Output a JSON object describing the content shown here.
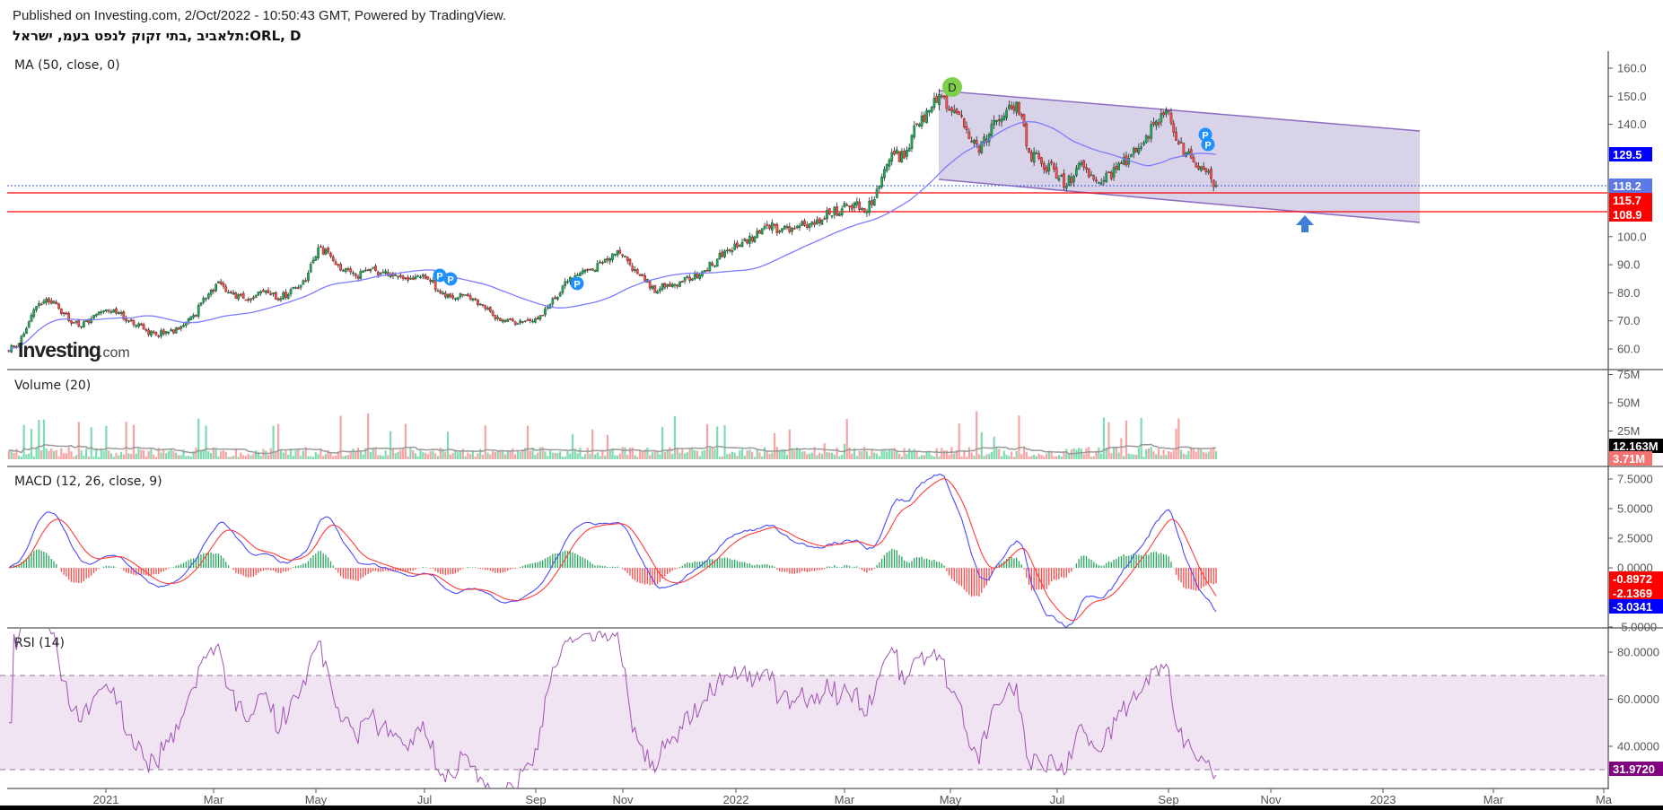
{
  "header": {
    "published": "Published on Investing.com, 2/Oct/2022 - 10:50:43 GMT, Powered by TradingView.",
    "symbol": "תלאביב ,בתי זקוק לנפט בעמ, ישראל:ORL, D"
  },
  "logo": {
    "main": "Investing",
    "suffix": ".com"
  },
  "panes": {
    "price": {
      "label": "MA (50, close, 0)",
      "ticks": [
        "160.0",
        "150.0",
        "140.0",
        "100.0",
        "90.0",
        "80.0",
        "70.0",
        "60.0"
      ],
      "tick_values": [
        160,
        150,
        140,
        100,
        90,
        80,
        70,
        60
      ]
    },
    "volume": {
      "label": "Volume (20)",
      "ticks": [
        "75M",
        "50M",
        "25M"
      ],
      "tick_values": [
        75,
        50,
        25
      ]
    },
    "macd": {
      "label": "MACD (12, 26, close, 9)",
      "ticks": [
        "7.5000",
        "5.0000",
        "2.5000",
        "0.0000",
        "-5.0000"
      ],
      "tick_values": [
        7.5,
        5,
        2.5,
        0,
        -5
      ]
    },
    "rsi": {
      "label": "RSI (14)",
      "ticks": [
        "80.0000",
        "60.0000",
        "40.0000"
      ],
      "tick_values": [
        80,
        60,
        40
      ]
    }
  },
  "price_tags": {
    "ma": {
      "text": "129.5",
      "color": "#0000ff"
    },
    "last": {
      "text": "118.2",
      "color": "#5b78e6"
    },
    "level1": {
      "text": "115.7",
      "color": "#ff0000"
    },
    "level2": {
      "text": "108.9",
      "color": "#ff0000"
    },
    "vol_ma": {
      "text": "12.163M",
      "color": "#000000"
    },
    "vol_last": {
      "text": "3.71M",
      "color": "#f77171"
    },
    "macd_hist": {
      "text": "-0.8972",
      "color": "#ff0000"
    },
    "macd_signal": {
      "text": "-2.1369",
      "color": "#ff0000"
    },
    "macd_line": {
      "text": "-3.0341",
      "color": "#0000ff"
    },
    "rsi": {
      "text": "31.9720",
      "color": "#800080"
    }
  },
  "x_axis": {
    "labels": [
      "2021",
      "Mar",
      "May",
      "Jul",
      "Sep",
      "Nov",
      "2022",
      "Mar",
      "May",
      "Jul",
      "Sep",
      "Nov",
      "2023",
      "Mar",
      "Ma"
    ]
  },
  "markers": {
    "dividend": "D",
    "p": "P"
  },
  "colors": {
    "up": "#26a65b",
    "down": "#ef5350",
    "ma": "#7b7bff",
    "channel": "#d8d3e8",
    "channel_edge": "#8d6cbf",
    "rsi": "#a052b5",
    "macd": "#4a4aff",
    "signal": "#ff3b3b"
  },
  "chart_data": {
    "type": "candlestick",
    "title": "ORL, D",
    "period": "2020-11 to 2022-09",
    "weekly_closes": [
      62,
      72,
      77,
      76,
      70,
      68,
      72,
      74,
      73,
      70,
      67,
      65,
      66,
      68,
      72,
      78,
      84,
      80,
      78,
      79,
      80,
      78,
      82,
      84,
      96,
      93,
      88,
      86,
      88,
      87,
      86,
      85,
      86,
      84,
      80,
      78,
      79,
      76,
      72,
      70,
      69,
      70,
      72,
      78,
      84,
      87,
      88,
      92,
      95,
      90,
      86,
      80,
      83,
      84,
      85,
      88,
      92,
      95,
      98,
      100,
      104,
      102,
      103,
      104,
      106,
      108,
      110,
      112,
      109,
      118,
      130,
      128,
      140,
      145,
      150,
      145,
      138,
      130,
      140,
      143,
      148,
      130,
      126,
      124,
      118,
      126,
      122,
      120,
      124,
      128,
      132,
      140,
      145,
      133,
      128,
      124,
      118.2
    ],
    "last_close": 118.2,
    "ma50_last": 129.5,
    "horizontal_levels": [
      118.2,
      115.7,
      108.9
    ],
    "channel": {
      "upper": [
        151,
        137
      ],
      "lower": [
        120,
        104.5
      ],
      "from": "2022-04",
      "to": "2023-01"
    },
    "ylim_price": [
      55,
      165
    ],
    "volume_ma20_last_M": 12.163,
    "volume_last_M": 3.71,
    "macd": {
      "fast": 12,
      "slow": 26,
      "signal": 9,
      "hist_last": -0.8972,
      "signal_last": -2.1369,
      "macd_last": -3.0341,
      "ylim": [
        -5.5,
        8
      ]
    },
    "rsi": {
      "period": 14,
      "last": 31.972,
      "upper_band": 70,
      "lower_band": 30,
      "ylim": [
        25,
        90
      ]
    }
  }
}
